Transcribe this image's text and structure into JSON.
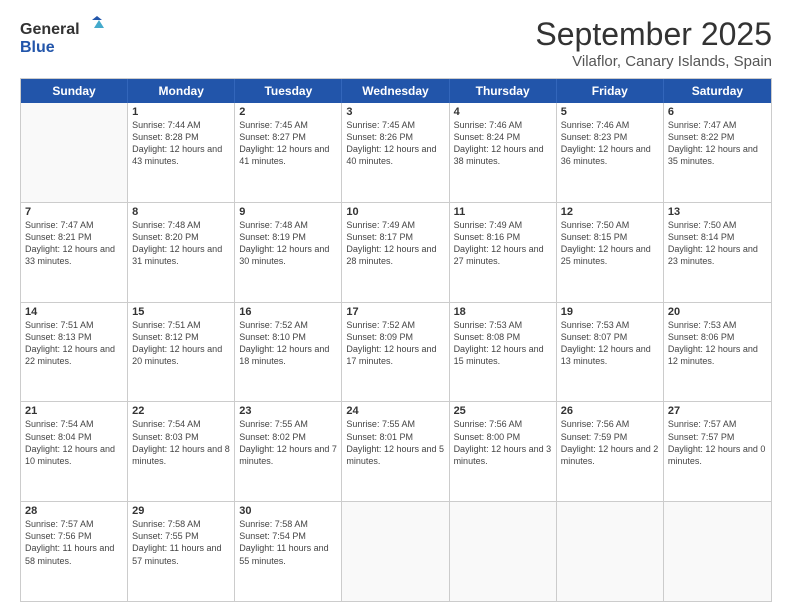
{
  "logo": {
    "line1": "General",
    "line2": "Blue"
  },
  "title": "September 2025",
  "subtitle": "Vilaflor, Canary Islands, Spain",
  "weekdays": [
    "Sunday",
    "Monday",
    "Tuesday",
    "Wednesday",
    "Thursday",
    "Friday",
    "Saturday"
  ],
  "weeks": [
    [
      {
        "day": "",
        "sunrise": "",
        "sunset": "",
        "daylight": ""
      },
      {
        "day": "1",
        "sunrise": "Sunrise: 7:44 AM",
        "sunset": "Sunset: 8:28 PM",
        "daylight": "Daylight: 12 hours and 43 minutes."
      },
      {
        "day": "2",
        "sunrise": "Sunrise: 7:45 AM",
        "sunset": "Sunset: 8:27 PM",
        "daylight": "Daylight: 12 hours and 41 minutes."
      },
      {
        "day": "3",
        "sunrise": "Sunrise: 7:45 AM",
        "sunset": "Sunset: 8:26 PM",
        "daylight": "Daylight: 12 hours and 40 minutes."
      },
      {
        "day": "4",
        "sunrise": "Sunrise: 7:46 AM",
        "sunset": "Sunset: 8:24 PM",
        "daylight": "Daylight: 12 hours and 38 minutes."
      },
      {
        "day": "5",
        "sunrise": "Sunrise: 7:46 AM",
        "sunset": "Sunset: 8:23 PM",
        "daylight": "Daylight: 12 hours and 36 minutes."
      },
      {
        "day": "6",
        "sunrise": "Sunrise: 7:47 AM",
        "sunset": "Sunset: 8:22 PM",
        "daylight": "Daylight: 12 hours and 35 minutes."
      }
    ],
    [
      {
        "day": "7",
        "sunrise": "Sunrise: 7:47 AM",
        "sunset": "Sunset: 8:21 PM",
        "daylight": "Daylight: 12 hours and 33 minutes."
      },
      {
        "day": "8",
        "sunrise": "Sunrise: 7:48 AM",
        "sunset": "Sunset: 8:20 PM",
        "daylight": "Daylight: 12 hours and 31 minutes."
      },
      {
        "day": "9",
        "sunrise": "Sunrise: 7:48 AM",
        "sunset": "Sunset: 8:19 PM",
        "daylight": "Daylight: 12 hours and 30 minutes."
      },
      {
        "day": "10",
        "sunrise": "Sunrise: 7:49 AM",
        "sunset": "Sunset: 8:17 PM",
        "daylight": "Daylight: 12 hours and 28 minutes."
      },
      {
        "day": "11",
        "sunrise": "Sunrise: 7:49 AM",
        "sunset": "Sunset: 8:16 PM",
        "daylight": "Daylight: 12 hours and 27 minutes."
      },
      {
        "day": "12",
        "sunrise": "Sunrise: 7:50 AM",
        "sunset": "Sunset: 8:15 PM",
        "daylight": "Daylight: 12 hours and 25 minutes."
      },
      {
        "day": "13",
        "sunrise": "Sunrise: 7:50 AM",
        "sunset": "Sunset: 8:14 PM",
        "daylight": "Daylight: 12 hours and 23 minutes."
      }
    ],
    [
      {
        "day": "14",
        "sunrise": "Sunrise: 7:51 AM",
        "sunset": "Sunset: 8:13 PM",
        "daylight": "Daylight: 12 hours and 22 minutes."
      },
      {
        "day": "15",
        "sunrise": "Sunrise: 7:51 AM",
        "sunset": "Sunset: 8:12 PM",
        "daylight": "Daylight: 12 hours and 20 minutes."
      },
      {
        "day": "16",
        "sunrise": "Sunrise: 7:52 AM",
        "sunset": "Sunset: 8:10 PM",
        "daylight": "Daylight: 12 hours and 18 minutes."
      },
      {
        "day": "17",
        "sunrise": "Sunrise: 7:52 AM",
        "sunset": "Sunset: 8:09 PM",
        "daylight": "Daylight: 12 hours and 17 minutes."
      },
      {
        "day": "18",
        "sunrise": "Sunrise: 7:53 AM",
        "sunset": "Sunset: 8:08 PM",
        "daylight": "Daylight: 12 hours and 15 minutes."
      },
      {
        "day": "19",
        "sunrise": "Sunrise: 7:53 AM",
        "sunset": "Sunset: 8:07 PM",
        "daylight": "Daylight: 12 hours and 13 minutes."
      },
      {
        "day": "20",
        "sunrise": "Sunrise: 7:53 AM",
        "sunset": "Sunset: 8:06 PM",
        "daylight": "Daylight: 12 hours and 12 minutes."
      }
    ],
    [
      {
        "day": "21",
        "sunrise": "Sunrise: 7:54 AM",
        "sunset": "Sunset: 8:04 PM",
        "daylight": "Daylight: 12 hours and 10 minutes."
      },
      {
        "day": "22",
        "sunrise": "Sunrise: 7:54 AM",
        "sunset": "Sunset: 8:03 PM",
        "daylight": "Daylight: 12 hours and 8 minutes."
      },
      {
        "day": "23",
        "sunrise": "Sunrise: 7:55 AM",
        "sunset": "Sunset: 8:02 PM",
        "daylight": "Daylight: 12 hours and 7 minutes."
      },
      {
        "day": "24",
        "sunrise": "Sunrise: 7:55 AM",
        "sunset": "Sunset: 8:01 PM",
        "daylight": "Daylight: 12 hours and 5 minutes."
      },
      {
        "day": "25",
        "sunrise": "Sunrise: 7:56 AM",
        "sunset": "Sunset: 8:00 PM",
        "daylight": "Daylight: 12 hours and 3 minutes."
      },
      {
        "day": "26",
        "sunrise": "Sunrise: 7:56 AM",
        "sunset": "Sunset: 7:59 PM",
        "daylight": "Daylight: 12 hours and 2 minutes."
      },
      {
        "day": "27",
        "sunrise": "Sunrise: 7:57 AM",
        "sunset": "Sunset: 7:57 PM",
        "daylight": "Daylight: 12 hours and 0 minutes."
      }
    ],
    [
      {
        "day": "28",
        "sunrise": "Sunrise: 7:57 AM",
        "sunset": "Sunset: 7:56 PM",
        "daylight": "Daylight: 11 hours and 58 minutes."
      },
      {
        "day": "29",
        "sunrise": "Sunrise: 7:58 AM",
        "sunset": "Sunset: 7:55 PM",
        "daylight": "Daylight: 11 hours and 57 minutes."
      },
      {
        "day": "30",
        "sunrise": "Sunrise: 7:58 AM",
        "sunset": "Sunset: 7:54 PM",
        "daylight": "Daylight: 11 hours and 55 minutes."
      },
      {
        "day": "",
        "sunrise": "",
        "sunset": "",
        "daylight": ""
      },
      {
        "day": "",
        "sunrise": "",
        "sunset": "",
        "daylight": ""
      },
      {
        "day": "",
        "sunrise": "",
        "sunset": "",
        "daylight": ""
      },
      {
        "day": "",
        "sunrise": "",
        "sunset": "",
        "daylight": ""
      }
    ]
  ]
}
